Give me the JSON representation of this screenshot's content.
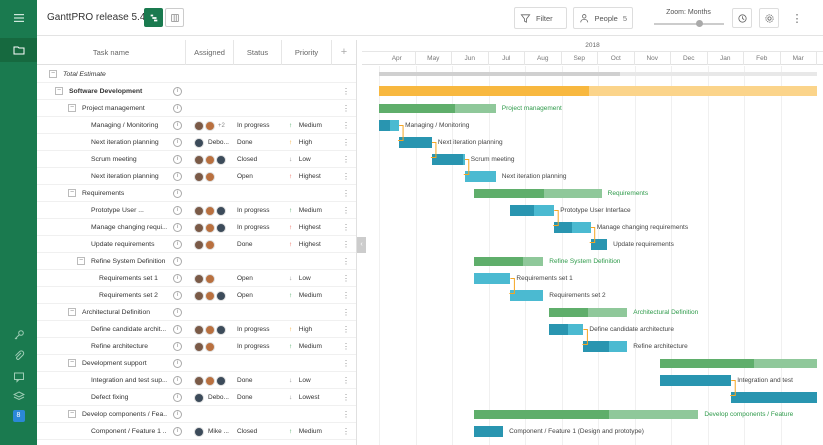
{
  "app": {
    "title": "GanttPRO release 5.4",
    "filter_label": "Filter",
    "people_label": "People",
    "people_count": "5",
    "zoom_label": "Zoom: Months"
  },
  "colors": {
    "brand": "#1a7a4f",
    "summary_bar": "#8fc89a",
    "summary_progress": "#5fae6b",
    "total_bar": "#fbd48a",
    "total_progress": "#f8b83f",
    "task_bar": "#4bbad1",
    "task_progress": "#2995b0",
    "link": "#f5a623",
    "high": "#f39c12",
    "low": "#888888",
    "medium": "#2e9a4a",
    "highest": "#e74c3c"
  },
  "columns": {
    "task_name": "Task name",
    "assigned": "Assigned",
    "status": "Status",
    "priority": "Priority",
    "add": "+"
  },
  "timeline": {
    "year": "2018",
    "months": [
      "Apr",
      "May",
      "Jun",
      "Jul",
      "Aug",
      "Sep",
      "Oct",
      "Nov",
      "Dec",
      "Jan",
      "Feb",
      "Mar"
    ]
  },
  "rows": [
    {
      "name": "Total Estimate",
      "level": 0,
      "type": "total",
      "toggle": "-",
      "italic": true
    },
    {
      "name": "Software Development",
      "level": 1,
      "type": "summary",
      "toggle": "-",
      "bold": true
    },
    {
      "name": "Project management",
      "level": 2,
      "type": "summary",
      "toggle": "-"
    },
    {
      "name": "Managing / Monitoring",
      "level": 3,
      "type": "task",
      "avatars": [
        "a1",
        "a2"
      ],
      "extra": "+2",
      "status": "In progress",
      "priority": "Medium",
      "prio": "up",
      "prio_color": "medium"
    },
    {
      "name": "Next iteration planning",
      "level": 3,
      "type": "task",
      "avatars": [
        "a3"
      ],
      "av_name": "Debo...",
      "status": "Done",
      "priority": "High",
      "prio": "up",
      "prio_color": "high"
    },
    {
      "name": "Scrum meeting",
      "level": 3,
      "type": "task",
      "avatars": [
        "a1",
        "a2",
        "a3"
      ],
      "status": "Closed",
      "priority": "Low",
      "prio": "down",
      "prio_color": "low"
    },
    {
      "name": "Next iteration planning",
      "level": 3,
      "type": "task",
      "avatars": [
        "a1",
        "a2"
      ],
      "status": "Open",
      "priority": "Highest",
      "prio": "up",
      "prio_color": "highest"
    },
    {
      "name": "Requirements",
      "level": 2,
      "type": "summary",
      "toggle": "-"
    },
    {
      "name": "Prototype User ...",
      "level": 3,
      "type": "task",
      "avatars": [
        "a1",
        "a2",
        "a3"
      ],
      "status": "In progress",
      "priority": "Medium",
      "prio": "up",
      "prio_color": "medium"
    },
    {
      "name": "Manage changing requi...",
      "level": 3,
      "type": "task",
      "avatars": [
        "a1",
        "a2",
        "a3"
      ],
      "status": "In progress",
      "priority": "Highest",
      "prio": "up",
      "prio_color": "highest"
    },
    {
      "name": "Update requirements",
      "level": 3,
      "type": "task",
      "avatars": [
        "a1",
        "a2"
      ],
      "status": "Done",
      "priority": "Highest",
      "prio": "up",
      "prio_color": "highest"
    },
    {
      "name": "Refine System Definition",
      "level": 2.5,
      "type": "summary",
      "toggle": "-"
    },
    {
      "name": "Requirements set 1",
      "level": 4,
      "type": "task",
      "avatars": [
        "a1",
        "a2"
      ],
      "status": "Open",
      "priority": "Low",
      "prio": "down",
      "prio_color": "low"
    },
    {
      "name": "Requirements set 2",
      "level": 4,
      "type": "task",
      "avatars": [
        "a1",
        "a2",
        "a3"
      ],
      "status": "Open",
      "priority": "Medium",
      "prio": "up",
      "prio_color": "medium"
    },
    {
      "name": "Architectural Definition",
      "level": 2,
      "type": "summary",
      "toggle": "-"
    },
    {
      "name": "Define candidate archit...",
      "level": 3,
      "type": "task",
      "avatars": [
        "a1",
        "a2",
        "a3"
      ],
      "status": "In progress",
      "priority": "High",
      "prio": "up",
      "prio_color": "high"
    },
    {
      "name": "Refine architecture",
      "level": 3,
      "type": "task",
      "avatars": [
        "a1",
        "a2"
      ],
      "status": "In progress",
      "priority": "Medium",
      "prio": "up",
      "prio_color": "medium"
    },
    {
      "name": "Development support",
      "level": 2,
      "type": "summary",
      "toggle": "-"
    },
    {
      "name": "Integration and test sup...",
      "level": 3,
      "type": "task",
      "avatars": [
        "a1",
        "a2",
        "a3"
      ],
      "status": "Done",
      "priority": "Low",
      "prio": "down",
      "prio_color": "low"
    },
    {
      "name": "Defect fixing",
      "level": 3,
      "type": "task",
      "avatars": [
        "a3"
      ],
      "av_name": "Debo...",
      "status": "Done",
      "priority": "Lowest",
      "prio": "down",
      "prio_color": "low"
    },
    {
      "name": "Develop components / Fea...",
      "level": 2,
      "type": "summary",
      "toggle": "-"
    },
    {
      "name": "Component / Feature 1 ...",
      "level": 3,
      "type": "task",
      "avatars": [
        "a3"
      ],
      "av_name": "Mike ...",
      "status": "Closed",
      "priority": "Medium",
      "prio": "up",
      "prio_color": "medium"
    }
  ],
  "bars": [
    {
      "row": 0,
      "kind": "total",
      "start": 0.0,
      "end": 12.0,
      "progress": 0.55
    },
    {
      "row": 1,
      "kind": "total",
      "start": 0.0,
      "end": 12.0,
      "progress": 0.48
    },
    {
      "row": 2,
      "kind": "summary",
      "start": 0.0,
      "end": 3.2,
      "progress": 0.65,
      "label": "Project management"
    },
    {
      "row": 3,
      "kind": "task",
      "start": 0.0,
      "end": 0.55,
      "progress": 0.55,
      "label": "Managing / Monitoring"
    },
    {
      "row": 4,
      "kind": "task",
      "start": 0.55,
      "end": 1.45,
      "progress": 1.0,
      "label": "Next iteration planning"
    },
    {
      "row": 5,
      "kind": "task",
      "start": 1.45,
      "end": 2.35,
      "progress": 0.95,
      "label": "Scrum meeting"
    },
    {
      "row": 6,
      "kind": "task",
      "start": 2.35,
      "end": 3.2,
      "progress": 0.0,
      "label": "Next iteration planning"
    },
    {
      "row": 7,
      "kind": "summary",
      "start": 2.6,
      "end": 6.1,
      "progress": 0.55,
      "label": "Requirements"
    },
    {
      "row": 8,
      "kind": "task",
      "start": 3.6,
      "end": 4.8,
      "progress": 0.55,
      "label": "Prototype User Interface"
    },
    {
      "row": 9,
      "kind": "task",
      "start": 4.8,
      "end": 5.8,
      "progress": 0.5,
      "label": "Manage changing requirements"
    },
    {
      "row": 10,
      "kind": "task",
      "start": 5.8,
      "end": 6.25,
      "progress": 1.0,
      "label": "Update requirements"
    },
    {
      "row": 11,
      "kind": "summary",
      "start": 2.6,
      "end": 4.5,
      "progress": 0.7,
      "label": "Refine System Definition"
    },
    {
      "row": 12,
      "kind": "task",
      "start": 2.6,
      "end": 3.6,
      "progress": 0.0,
      "label": "Requirements set 1"
    },
    {
      "row": 13,
      "kind": "task",
      "start": 3.6,
      "end": 4.5,
      "progress": 0.0,
      "label": "Requirements set 2"
    },
    {
      "row": 14,
      "kind": "summary",
      "start": 4.65,
      "end": 6.8,
      "progress": 0.5,
      "label": "Architectural Definition"
    },
    {
      "row": 15,
      "kind": "task",
      "start": 4.65,
      "end": 5.6,
      "progress": 0.55,
      "label": "Define candidate architecture"
    },
    {
      "row": 16,
      "kind": "task",
      "start": 5.6,
      "end": 6.8,
      "progress": 0.6,
      "label": "Refine architecture"
    },
    {
      "row": 17,
      "kind": "summary",
      "start": 7.7,
      "end": 12.0,
      "progress": 0.6
    },
    {
      "row": 18,
      "kind": "task",
      "start": 7.7,
      "end": 9.65,
      "progress": 1.0,
      "label": "Integration and test"
    },
    {
      "row": 19,
      "kind": "task",
      "start": 9.65,
      "end": 12.0,
      "progress": 1.0
    },
    {
      "row": 20,
      "kind": "summary",
      "start": 2.6,
      "end": 8.75,
      "progress": 0.6,
      "label": "Develop components / Feature"
    },
    {
      "row": 21,
      "kind": "task",
      "start": 2.6,
      "end": 3.4,
      "progress": 1.0,
      "label": "Component / Feature 1 (Design and prototype)"
    }
  ],
  "links": [
    [
      3,
      4
    ],
    [
      4,
      5
    ],
    [
      5,
      6
    ],
    [
      8,
      9
    ],
    [
      9,
      10
    ],
    [
      12,
      13
    ],
    [
      15,
      16
    ],
    [
      18,
      19
    ]
  ]
}
